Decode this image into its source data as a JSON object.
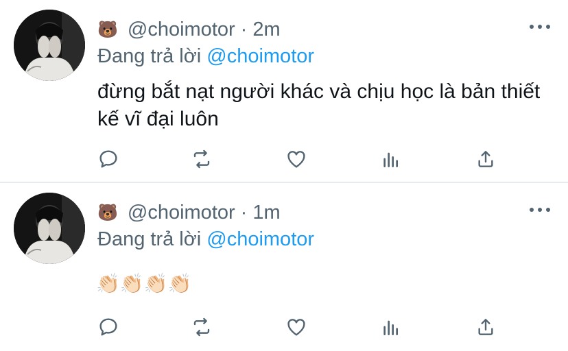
{
  "tweets": [
    {
      "emoji": "🐻",
      "handle": "@choimotor",
      "separator": "·",
      "time": "2m",
      "reply_prefix": "Đang trả lời",
      "reply_mention": "@choimotor",
      "text": "đừng bắt nạt người khác và chịu học là bản thiết kế vĩ đại luôn"
    },
    {
      "emoji": "🐻",
      "handle": "@choimotor",
      "separator": "·",
      "time": "1m",
      "reply_prefix": "Đang trả lời",
      "reply_mention": "@choimotor",
      "text": "👏🏻👏🏻👏🏻👏🏻"
    }
  ],
  "icons": {
    "reply": "reply-icon",
    "retweet": "retweet-icon",
    "like": "heart-icon",
    "analytics": "analytics-icon",
    "share": "share-icon",
    "more": "more-icon"
  },
  "colors": {
    "secondary_text": "#536471",
    "mention": "#1d9bf0",
    "divider": "#e6ecf0"
  }
}
